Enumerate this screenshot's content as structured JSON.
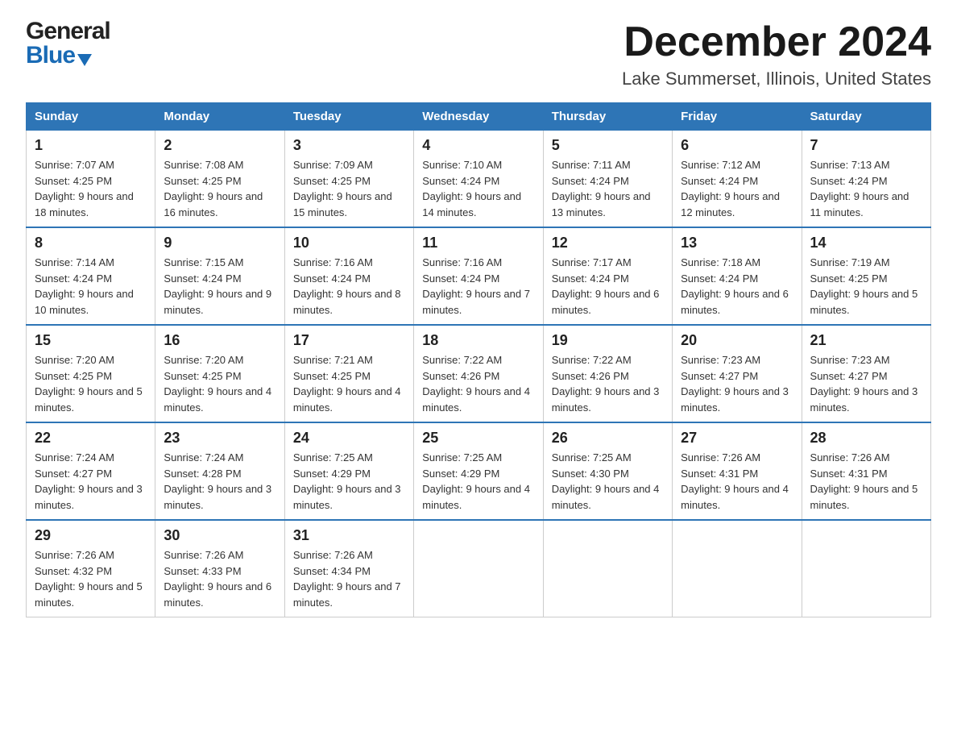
{
  "header": {
    "logo_general": "General",
    "logo_blue": "Blue",
    "month_title": "December 2024",
    "location": "Lake Summerset, Illinois, United States"
  },
  "days_of_week": [
    "Sunday",
    "Monday",
    "Tuesday",
    "Wednesday",
    "Thursday",
    "Friday",
    "Saturday"
  ],
  "weeks": [
    [
      {
        "day": "1",
        "sunrise": "Sunrise: 7:07 AM",
        "sunset": "Sunset: 4:25 PM",
        "daylight": "Daylight: 9 hours and 18 minutes."
      },
      {
        "day": "2",
        "sunrise": "Sunrise: 7:08 AM",
        "sunset": "Sunset: 4:25 PM",
        "daylight": "Daylight: 9 hours and 16 minutes."
      },
      {
        "day": "3",
        "sunrise": "Sunrise: 7:09 AM",
        "sunset": "Sunset: 4:25 PM",
        "daylight": "Daylight: 9 hours and 15 minutes."
      },
      {
        "day": "4",
        "sunrise": "Sunrise: 7:10 AM",
        "sunset": "Sunset: 4:24 PM",
        "daylight": "Daylight: 9 hours and 14 minutes."
      },
      {
        "day": "5",
        "sunrise": "Sunrise: 7:11 AM",
        "sunset": "Sunset: 4:24 PM",
        "daylight": "Daylight: 9 hours and 13 minutes."
      },
      {
        "day": "6",
        "sunrise": "Sunrise: 7:12 AM",
        "sunset": "Sunset: 4:24 PM",
        "daylight": "Daylight: 9 hours and 12 minutes."
      },
      {
        "day": "7",
        "sunrise": "Sunrise: 7:13 AM",
        "sunset": "Sunset: 4:24 PM",
        "daylight": "Daylight: 9 hours and 11 minutes."
      }
    ],
    [
      {
        "day": "8",
        "sunrise": "Sunrise: 7:14 AM",
        "sunset": "Sunset: 4:24 PM",
        "daylight": "Daylight: 9 hours and 10 minutes."
      },
      {
        "day": "9",
        "sunrise": "Sunrise: 7:15 AM",
        "sunset": "Sunset: 4:24 PM",
        "daylight": "Daylight: 9 hours and 9 minutes."
      },
      {
        "day": "10",
        "sunrise": "Sunrise: 7:16 AM",
        "sunset": "Sunset: 4:24 PM",
        "daylight": "Daylight: 9 hours and 8 minutes."
      },
      {
        "day": "11",
        "sunrise": "Sunrise: 7:16 AM",
        "sunset": "Sunset: 4:24 PM",
        "daylight": "Daylight: 9 hours and 7 minutes."
      },
      {
        "day": "12",
        "sunrise": "Sunrise: 7:17 AM",
        "sunset": "Sunset: 4:24 PM",
        "daylight": "Daylight: 9 hours and 6 minutes."
      },
      {
        "day": "13",
        "sunrise": "Sunrise: 7:18 AM",
        "sunset": "Sunset: 4:24 PM",
        "daylight": "Daylight: 9 hours and 6 minutes."
      },
      {
        "day": "14",
        "sunrise": "Sunrise: 7:19 AM",
        "sunset": "Sunset: 4:25 PM",
        "daylight": "Daylight: 9 hours and 5 minutes."
      }
    ],
    [
      {
        "day": "15",
        "sunrise": "Sunrise: 7:20 AM",
        "sunset": "Sunset: 4:25 PM",
        "daylight": "Daylight: 9 hours and 5 minutes."
      },
      {
        "day": "16",
        "sunrise": "Sunrise: 7:20 AM",
        "sunset": "Sunset: 4:25 PM",
        "daylight": "Daylight: 9 hours and 4 minutes."
      },
      {
        "day": "17",
        "sunrise": "Sunrise: 7:21 AM",
        "sunset": "Sunset: 4:25 PM",
        "daylight": "Daylight: 9 hours and 4 minutes."
      },
      {
        "day": "18",
        "sunrise": "Sunrise: 7:22 AM",
        "sunset": "Sunset: 4:26 PM",
        "daylight": "Daylight: 9 hours and 4 minutes."
      },
      {
        "day": "19",
        "sunrise": "Sunrise: 7:22 AM",
        "sunset": "Sunset: 4:26 PM",
        "daylight": "Daylight: 9 hours and 3 minutes."
      },
      {
        "day": "20",
        "sunrise": "Sunrise: 7:23 AM",
        "sunset": "Sunset: 4:27 PM",
        "daylight": "Daylight: 9 hours and 3 minutes."
      },
      {
        "day": "21",
        "sunrise": "Sunrise: 7:23 AM",
        "sunset": "Sunset: 4:27 PM",
        "daylight": "Daylight: 9 hours and 3 minutes."
      }
    ],
    [
      {
        "day": "22",
        "sunrise": "Sunrise: 7:24 AM",
        "sunset": "Sunset: 4:27 PM",
        "daylight": "Daylight: 9 hours and 3 minutes."
      },
      {
        "day": "23",
        "sunrise": "Sunrise: 7:24 AM",
        "sunset": "Sunset: 4:28 PM",
        "daylight": "Daylight: 9 hours and 3 minutes."
      },
      {
        "day": "24",
        "sunrise": "Sunrise: 7:25 AM",
        "sunset": "Sunset: 4:29 PM",
        "daylight": "Daylight: 9 hours and 3 minutes."
      },
      {
        "day": "25",
        "sunrise": "Sunrise: 7:25 AM",
        "sunset": "Sunset: 4:29 PM",
        "daylight": "Daylight: 9 hours and 4 minutes."
      },
      {
        "day": "26",
        "sunrise": "Sunrise: 7:25 AM",
        "sunset": "Sunset: 4:30 PM",
        "daylight": "Daylight: 9 hours and 4 minutes."
      },
      {
        "day": "27",
        "sunrise": "Sunrise: 7:26 AM",
        "sunset": "Sunset: 4:31 PM",
        "daylight": "Daylight: 9 hours and 4 minutes."
      },
      {
        "day": "28",
        "sunrise": "Sunrise: 7:26 AM",
        "sunset": "Sunset: 4:31 PM",
        "daylight": "Daylight: 9 hours and 5 minutes."
      }
    ],
    [
      {
        "day": "29",
        "sunrise": "Sunrise: 7:26 AM",
        "sunset": "Sunset: 4:32 PM",
        "daylight": "Daylight: 9 hours and 5 minutes."
      },
      {
        "day": "30",
        "sunrise": "Sunrise: 7:26 AM",
        "sunset": "Sunset: 4:33 PM",
        "daylight": "Daylight: 9 hours and 6 minutes."
      },
      {
        "day": "31",
        "sunrise": "Sunrise: 7:26 AM",
        "sunset": "Sunset: 4:34 PM",
        "daylight": "Daylight: 9 hours and 7 minutes."
      },
      null,
      null,
      null,
      null
    ]
  ]
}
